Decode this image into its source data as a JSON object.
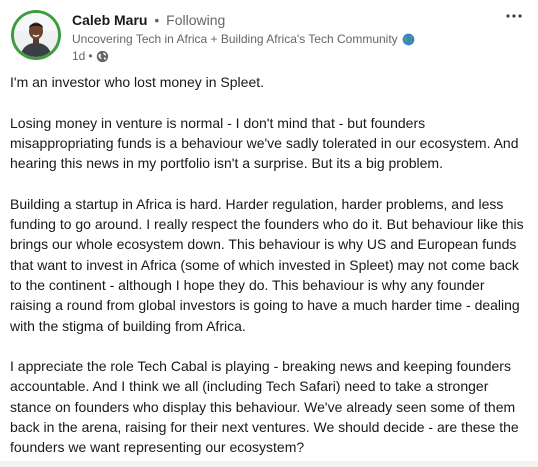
{
  "author": {
    "name": "Caleb Maru",
    "separator": "•",
    "follow_status": "Following",
    "headline": "Uncovering Tech in Africa + Building Africa's Tech Community",
    "headline_icon": "globe-icon",
    "time_ago": "1d",
    "time_separator": "•",
    "visibility_icon": "globe-icon"
  },
  "menu": {
    "icon": "more-horizontal-icon"
  },
  "post": {
    "paragraphs": [
      "I'm an investor who lost money in Spleet.",
      "Losing money in venture is normal - I don't mind that - but founders misappropriating funds is a behaviour we've sadly tolerated in our ecosystem. And hearing this news in my portfolio isn't a surprise. But its a big problem.",
      "Building a startup in Africa is hard. Harder regulation, harder problems, and less funding to go around. I really respect the founders who do it. But behaviour like this brings our whole ecosystem down. This behaviour is why US and European funds that want to invest in Africa (some of which invested in Spleet) may not come back to the continent - although I hope they do. This behaviour is why any founder raising a round from global investors is going to have a much harder time - dealing with the stigma of building from Africa.",
      "I appreciate the role Tech Cabal is playing - breaking news and keeping founders accountable. And I think we all (including Tech Safari) need to take a stronger stance on founders who display this behaviour. We've already seen some of them back in the arena, raising for their next ventures. We should decide - are these the founders we want representing our ecosystem?"
    ]
  },
  "colors": {
    "avatar_ring": "#3f9b3f",
    "text_primary": "#191919",
    "text_secondary": "#666666",
    "globe_blue": "#3b82c4",
    "globe_green": "#4caf50"
  }
}
